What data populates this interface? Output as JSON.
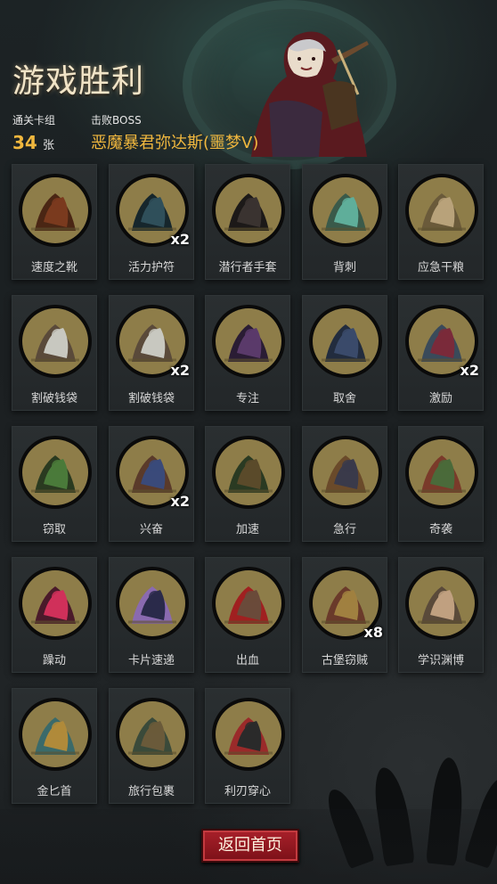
{
  "title": "游戏胜利",
  "stats": {
    "cards_label": "通关卡组",
    "cards_count": "34",
    "cards_unit": "张",
    "boss_label": "击败BOSS",
    "boss_name": "恶魔暴君弥达斯(噩梦V)"
  },
  "cards": [
    {
      "name": "速度之靴",
      "qty": "",
      "icon": "boots-icon"
    },
    {
      "name": "活力护符",
      "qty": "x2",
      "icon": "amulet-icon"
    },
    {
      "name": "潜行者手套",
      "qty": "",
      "icon": "glove-icon"
    },
    {
      "name": "背刺",
      "qty": "",
      "icon": "backstab-icon"
    },
    {
      "name": "应急干粮",
      "qty": "",
      "icon": "rations-icon"
    },
    {
      "name": "割破钱袋",
      "qty": "",
      "icon": "cut-purse-icon"
    },
    {
      "name": "割破钱袋",
      "qty": "x2",
      "icon": "cut-purse-icon"
    },
    {
      "name": "专注",
      "qty": "",
      "icon": "focus-icon"
    },
    {
      "name": "取舍",
      "qty": "",
      "icon": "tradeoff-icon"
    },
    {
      "name": "激励",
      "qty": "x2",
      "icon": "inspire-icon"
    },
    {
      "name": "窃取",
      "qty": "",
      "icon": "steal-icon"
    },
    {
      "name": "兴奋",
      "qty": "x2",
      "icon": "excite-icon"
    },
    {
      "name": "加速",
      "qty": "",
      "icon": "haste-icon"
    },
    {
      "name": "急行",
      "qty": "",
      "icon": "rush-icon"
    },
    {
      "name": "奇袭",
      "qty": "",
      "icon": "ambush-icon"
    },
    {
      "name": "躁动",
      "qty": "",
      "icon": "frenzy-icon"
    },
    {
      "name": "卡片速递",
      "qty": "",
      "icon": "card-express-icon"
    },
    {
      "name": "出血",
      "qty": "",
      "icon": "bleed-icon"
    },
    {
      "name": "古堡窃贼",
      "qty": "x8",
      "icon": "castle-thief-icon"
    },
    {
      "name": "学识渊博",
      "qty": "",
      "icon": "scholar-icon"
    },
    {
      "name": "金匕首",
      "qty": "",
      "icon": "golden-dagger-icon"
    },
    {
      "name": "旅行包裹",
      "qty": "",
      "icon": "travel-pack-icon"
    },
    {
      "name": "利刃穿心",
      "qty": "",
      "icon": "pierce-heart-icon"
    }
  ],
  "home_button": "返回首页",
  "colors": {
    "accent": "#f0b73e",
    "medal": "#8e7d49",
    "button": "#a8202a"
  }
}
